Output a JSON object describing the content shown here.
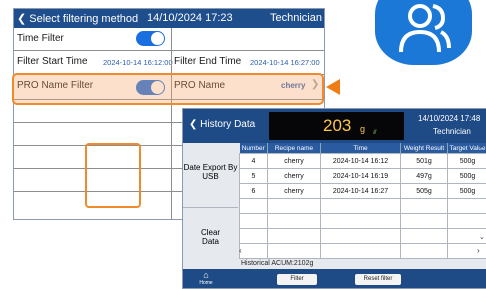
{
  "filter_panel": {
    "back_label": "Select filtering method",
    "datetime": "14/10/2024 17:23",
    "role": "Technician",
    "time_filter_label": "Time Filter",
    "time_filter_on": true,
    "start_label": "Filter Start Time",
    "start_value": "2024-10-14 16:12:00",
    "end_label": "Filter End Time",
    "end_value": "2024-10-14 16:27:00",
    "pro_filter_label": "PRO Name Filter",
    "pro_filter_on": true,
    "pro_name_label": "PRO Name",
    "pro_name_value": "cherry"
  },
  "history_panel": {
    "back_label": "History Data",
    "weight": "203",
    "weight_unit": "g",
    "datetime": "14/10/2024 17:48",
    "role": "Technician",
    "export_label": "Date Export By USB",
    "clear_label": "Clear Data",
    "columns": [
      "Number",
      "Recipe name",
      "Time",
      "Weight Result",
      "Target Value"
    ],
    "rows": [
      {
        "number": "4",
        "recipe": "cherry",
        "time": "2024-10-14 16:12",
        "weight": "501g",
        "target": "500g"
      },
      {
        "number": "5",
        "recipe": "cherry",
        "time": "2024-10-14 16:19",
        "weight": "497g",
        "target": "500g"
      },
      {
        "number": "6",
        "recipe": "cherry",
        "time": "2024-10-14 16:27",
        "weight": "505g",
        "target": "500g"
      }
    ],
    "acum_label": "Historical ACUM:2102g",
    "home_label": "Home",
    "filter_label": "Filter",
    "reset_label": "Reset filter"
  },
  "colors": {
    "accent": "#1f4e8c",
    "highlight": "#f08a2c",
    "toggle": "#1a6fe0",
    "badge": "#1b78d6"
  }
}
